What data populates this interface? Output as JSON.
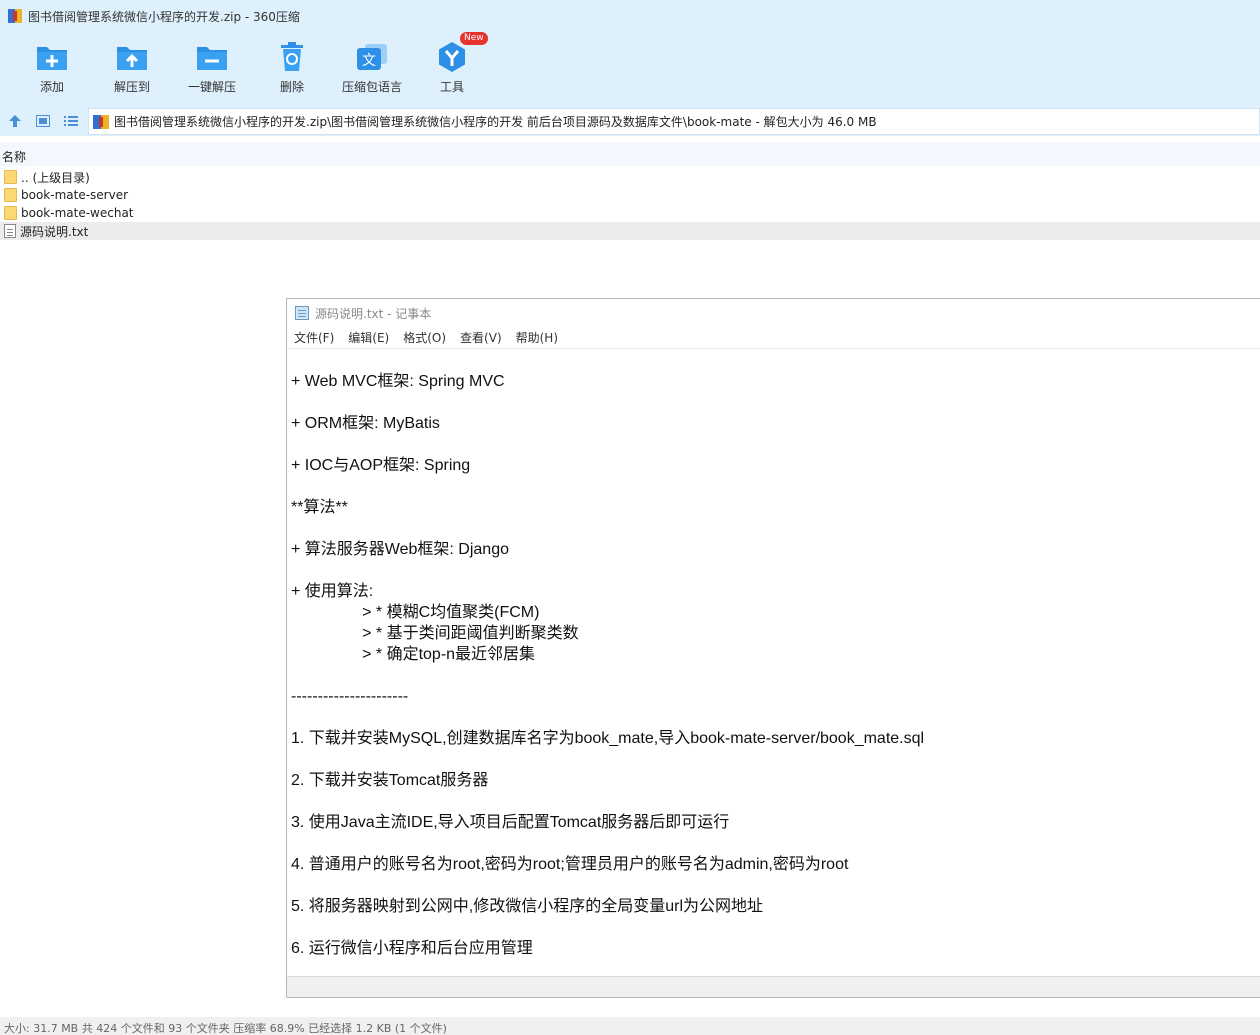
{
  "window": {
    "title": "图书借阅管理系统微信小程序的开发.zip - 360压缩"
  },
  "toolbar": {
    "items": [
      {
        "label": "添加",
        "icon": "add-icon"
      },
      {
        "label": "解压到",
        "icon": "extract-to-icon"
      },
      {
        "label": "一键解压",
        "icon": "one-click-extract-icon"
      },
      {
        "label": "删除",
        "icon": "trash-icon"
      },
      {
        "label": "压缩包语言",
        "icon": "language-icon"
      },
      {
        "label": "工具",
        "icon": "tools-icon",
        "badge": "New"
      }
    ]
  },
  "address": {
    "path": "图书借阅管理系统微信小程序的开发.zip\\图书借阅管理系统微信小程序的开发 前后台项目源码及数据库文件\\book-mate - 解包大小为 46.0 MB"
  },
  "list": {
    "header": "名称",
    "rows": [
      {
        "name": ".. (上级目录)",
        "type": "folder"
      },
      {
        "name": "book-mate-server",
        "type": "folder"
      },
      {
        "name": "book-mate-wechat",
        "type": "folder"
      },
      {
        "name": "源码说明.txt",
        "type": "txt"
      }
    ]
  },
  "status": {
    "text": "大小: 31.7 MB 共 424 个文件和 93 个文件夹 压缩率 68.9% 已经选择 1.2 KB (1 个文件)"
  },
  "notepad": {
    "title": "源码说明.txt - 记事本",
    "menu": [
      "文件(F)",
      "编辑(E)",
      "格式(O)",
      "查看(V)",
      "帮助(H)"
    ],
    "lines": [
      "+ Web MVC框架: Spring MVC",
      "",
      "+ ORM框架: MyBatis",
      "",
      "+ IOC与AOP框架: Spring",
      "",
      "**算法**",
      "",
      "+ 算法服务器Web框架: Django",
      "",
      "+ 使用算法:",
      "                > * 模糊C均值聚类(FCM)",
      "                > * 基于类间距阈值判断聚类数",
      "                > * 确定top-n最近邻居集",
      "",
      "----------------------",
      "",
      "1. 下载并安装MySQL,创建数据库名字为book_mate,导入book-mate-server/book_mate.sql",
      "",
      "2. 下载并安装Tomcat服务器",
      "",
      "3. 使用Java主流IDE,导入项目后配置Tomcat服务器后即可运行",
      "",
      "4. 普通用户的账号名为root,密码为root;管理员用户的账号名为admin,密码为root",
      "",
      "5. 将服务器映射到公网中,修改微信小程序的全局变量url为公网地址",
      "",
      "6. 运行微信小程序和后台应用管理"
    ]
  }
}
